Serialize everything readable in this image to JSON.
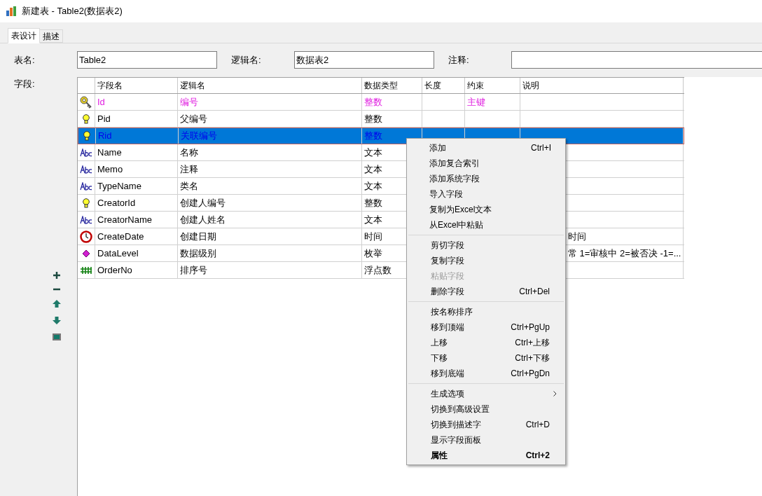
{
  "window": {
    "title": "新建表 - Table2(数据表2)"
  },
  "tabs": [
    {
      "label": "表设计",
      "selected": true
    },
    {
      "label": "描述",
      "selected": false
    }
  ],
  "form": {
    "table_name": {
      "label": "表名:",
      "value": "Table2"
    },
    "logical_name": {
      "label": "逻辑名:",
      "value": "数据表2"
    },
    "comment": {
      "label": "注释:"
    }
  },
  "fields_label": "字段:",
  "table": {
    "columns": [
      "字段名",
      "逻辑名",
      "数据类型",
      "长度",
      "约束",
      "说明"
    ],
    "rows": [
      {
        "kind": "key",
        "name": "Id",
        "logical": "编号",
        "type": "整数",
        "constraint": "主键",
        "primary": true,
        "selected": false
      },
      {
        "kind": "bulb",
        "name": "Pid",
        "logical": "父编号",
        "type": "整数",
        "primary": false,
        "selected": false
      },
      {
        "kind": "bulb",
        "name": "Rid",
        "logical": "关联编号",
        "type": "整数",
        "primary": false,
        "selected": true
      },
      {
        "kind": "text",
        "name": "Name",
        "logical": "名称",
        "type": "文本",
        "primary": false,
        "selected": false
      },
      {
        "kind": "text",
        "name": "Memo",
        "logical": "注释",
        "type": "文本",
        "primary": false,
        "selected": false
      },
      {
        "kind": "text",
        "name": "TypeName",
        "logical": "类名",
        "type": "文本",
        "primary": false,
        "selected": false
      },
      {
        "kind": "bulb",
        "name": "CreatorId",
        "logical": "创建人编号",
        "type": "整数",
        "primary": false,
        "selected": false
      },
      {
        "kind": "text",
        "name": "CreatorName",
        "logical": "创建人姓名",
        "type": "文本",
        "primary": false,
        "selected": false
      },
      {
        "kind": "clock",
        "name": "CreateDate",
        "logical": "创建日期",
        "type": "时间",
        "description": "时间",
        "primary": false,
        "selected": false
      },
      {
        "kind": "diamond",
        "name": "DataLevel",
        "logical": "数据级别",
        "type": "枚举",
        "description": "常 1=审核中 2=被否决 -1=...",
        "primary": false,
        "selected": false
      },
      {
        "kind": "hash",
        "name": "OrderNo",
        "logical": "排序号",
        "type": "浮点数",
        "primary": false,
        "selected": false
      }
    ]
  },
  "context_menu": {
    "groups": [
      [
        {
          "label": "添加",
          "shortcut": "Ctrl+I",
          "disabled": false,
          "bold": false
        },
        {
          "label": "添加复合索引",
          "disabled": false,
          "bold": false
        },
        {
          "label": "添加系统字段",
          "disabled": false,
          "bold": false
        },
        {
          "label": "导入字段",
          "disabled": false,
          "bold": false
        },
        {
          "label": "复制为Excel文本",
          "disabled": false,
          "bold": false
        },
        {
          "label": "从Excel中粘贴",
          "disabled": false,
          "bold": false
        }
      ],
      [
        {
          "label": "剪切字段",
          "disabled": false,
          "bold": false
        },
        {
          "label": "复制字段",
          "disabled": false,
          "bold": false
        },
        {
          "label": "粘贴字段",
          "disabled": true,
          "bold": false
        },
        {
          "label": "删除字段",
          "shortcut": "Ctrl+Del",
          "disabled": false,
          "bold": false
        }
      ],
      [
        {
          "label": "按名称排序",
          "disabled": false,
          "bold": false
        },
        {
          "label": "移到顶端",
          "shortcut": "Ctrl+PgUp",
          "disabled": false,
          "bold": false
        },
        {
          "label": "上移",
          "shortcut": "Ctrl+上移",
          "disabled": false,
          "bold": false
        },
        {
          "label": "下移",
          "shortcut": "Ctrl+下移",
          "disabled": false,
          "bold": false
        },
        {
          "label": "移到底端",
          "shortcut": "Ctrl+PgDn",
          "disabled": false,
          "bold": false
        }
      ],
      [
        {
          "label": "生成选项",
          "submenu": true,
          "disabled": false,
          "bold": false
        },
        {
          "label": "切换到高级设置",
          "disabled": false,
          "bold": false
        },
        {
          "label": "切换到描述字",
          "shortcut": "Ctrl+D",
          "disabled": false,
          "bold": false
        },
        {
          "label": "显示字段面板",
          "disabled": false,
          "bold": false
        },
        {
          "label": "属性",
          "shortcut": "Ctrl+2",
          "disabled": false,
          "bold": true
        }
      ]
    ]
  }
}
